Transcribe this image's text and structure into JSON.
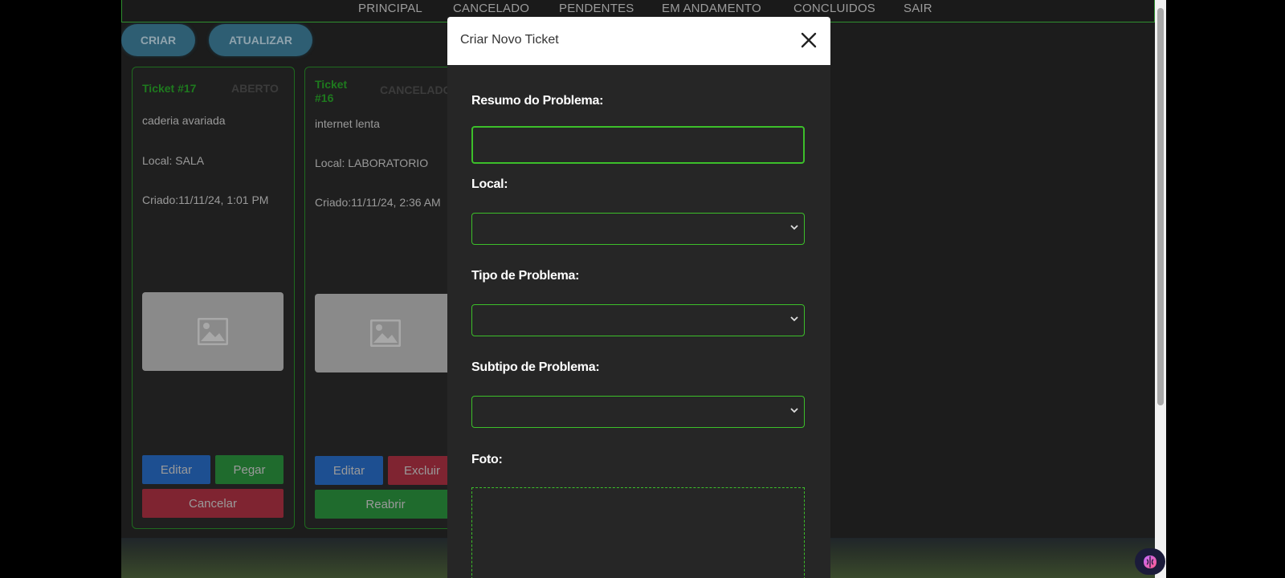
{
  "nav": [
    "PRINCIPAL",
    "CANCELADO",
    "PENDENTES",
    "EM ANDAMENTO",
    "CONCLUIDOS",
    "SAIR"
  ],
  "actions": {
    "create": "CRIAR",
    "refresh": "ATUALIZAR"
  },
  "tickets": [
    {
      "number": "Ticket #17",
      "status": "ABERTO",
      "summary": "caderia avariada",
      "location": "Local: SALA",
      "created": "Criado:11/11/24, 1:01 PM",
      "buttons": [
        "Editar",
        "Pegar",
        "Cancelar"
      ]
    },
    {
      "number": "Ticket #16",
      "number_line1": "Ticket",
      "number_line2": "#16",
      "status": "CANCELADO",
      "summary": "internet lenta",
      "location": "Local: LABORATORIO",
      "created": "Criado:11/11/24, 2:36 AM",
      "buttons": [
        "Editar",
        "Excluir",
        "Reabrir"
      ]
    }
  ],
  "modal": {
    "title": "Criar Novo Ticket",
    "fields": {
      "summary_label": "Resumo do Problema:",
      "summary_value": "",
      "location_label": "Local:",
      "location_value": "",
      "type_label": "Tipo de Problema:",
      "type_value": "",
      "subtype_label": "Subtipo de Problema:",
      "subtype_value": "",
      "photo_label": "Foto:"
    }
  },
  "colors": {
    "accent_green": "#3cbf2a",
    "button_blue": "#1d4f91",
    "button_green": "#1f6b2d",
    "button_red": "#7f2431",
    "pill_blue": "#2e5e73"
  },
  "icons": [
    "close-icon",
    "image-placeholder-icon",
    "chevron-down-icon",
    "extension-icon"
  ]
}
